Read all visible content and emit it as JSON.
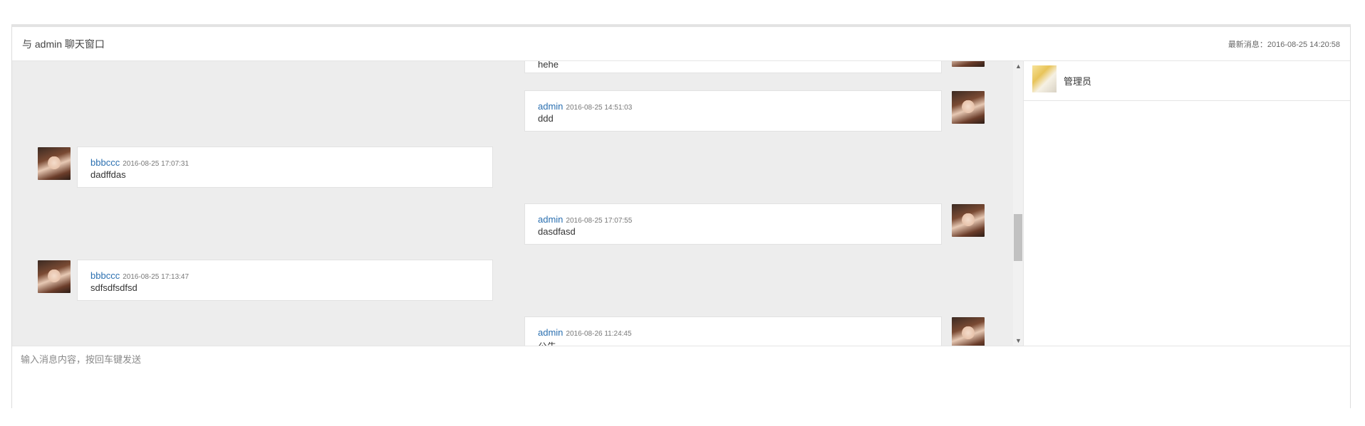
{
  "header": {
    "title": "与 admin 聊天窗口",
    "latest_label": "最新消息：2016-08-25 14:20:58"
  },
  "messages": [
    {
      "side": "right",
      "sender": "",
      "time": "",
      "content": "hehe"
    },
    {
      "side": "right",
      "sender": "admin",
      "time": "2016-08-25 14:51:03",
      "content": "ddd"
    },
    {
      "side": "left",
      "sender": "bbbccc",
      "time": "2016-08-25 17:07:31",
      "content": "dadffdas"
    },
    {
      "side": "right",
      "sender": "admin",
      "time": "2016-08-25 17:07:55",
      "content": "dasdfasd"
    },
    {
      "side": "left",
      "sender": "bbbccc",
      "time": "2016-08-25 17:13:47",
      "content": "sdfsdfsdfsd"
    },
    {
      "side": "right",
      "sender": "admin",
      "time": "2016-08-26 11:24:45",
      "content": "公告"
    }
  ],
  "users": [
    {
      "name": "管理员",
      "avatar_icon": "user-avatar-flower"
    }
  ],
  "scrollbar": {
    "up_icon": "scroll-up-icon",
    "down_icon": "scroll-down-icon"
  },
  "input": {
    "placeholder": "输入消息内容，按回车键发送",
    "value": ""
  }
}
